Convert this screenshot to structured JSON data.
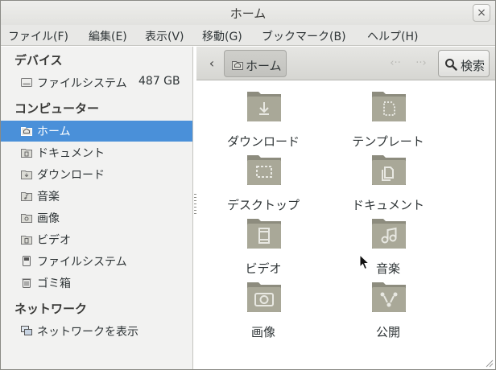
{
  "window": {
    "title": "ホーム",
    "close_glyph": "×"
  },
  "menubar": [
    {
      "label": "ファイル(F)"
    },
    {
      "label": "編集(E)"
    },
    {
      "label": "表示(V)"
    },
    {
      "label": "移動(G)"
    },
    {
      "label": "ブックマーク(B)"
    },
    {
      "label": "ヘルプ(H)"
    }
  ],
  "sidebar": {
    "devices_heading": "デバイス",
    "devices": [
      {
        "label": "ファイルシステム",
        "extra": "487 GB",
        "icon": "drive-icon"
      }
    ],
    "computer_heading": "コンピューター",
    "computer": [
      {
        "label": "ホーム",
        "icon": "home-folder-icon",
        "selected": true
      },
      {
        "label": "ドキュメント",
        "icon": "documents-folder-icon"
      },
      {
        "label": "ダウンロード",
        "icon": "downloads-folder-icon"
      },
      {
        "label": "音楽",
        "icon": "music-folder-icon"
      },
      {
        "label": "画像",
        "icon": "pictures-folder-icon"
      },
      {
        "label": "ビデオ",
        "icon": "videos-folder-icon"
      },
      {
        "label": "ファイルシステム",
        "icon": "filesystem-icon"
      },
      {
        "label": "ゴミ箱",
        "icon": "trash-icon"
      }
    ],
    "network_heading": "ネットワーク",
    "network": [
      {
        "label": "ネットワークを表示",
        "icon": "network-icon"
      }
    ]
  },
  "toolbar": {
    "back_glyph": "‹",
    "crumb_label": "ホーム",
    "prev_glyph": "‹··",
    "next_glyph": "··›",
    "search_label": "検索"
  },
  "folders": [
    {
      "label": "ダウンロード",
      "icon": "downloads-folder-icon"
    },
    {
      "label": "テンプレート",
      "icon": "templates-folder-icon"
    },
    {
      "label": "デスクトップ",
      "icon": "desktop-folder-icon"
    },
    {
      "label": "ドキュメント",
      "icon": "documents-folder-icon"
    },
    {
      "label": "ビデオ",
      "icon": "videos-folder-icon"
    },
    {
      "label": "音楽",
      "icon": "music-folder-icon"
    },
    {
      "label": "画像",
      "icon": "pictures-folder-icon"
    },
    {
      "label": "公開",
      "icon": "public-folder-icon"
    }
  ],
  "colors": {
    "selection": "#4a90d9",
    "folder": "#a9a898",
    "folder_dark": "#8d8c7e",
    "sidebar_bg": "#f2f2f1"
  }
}
